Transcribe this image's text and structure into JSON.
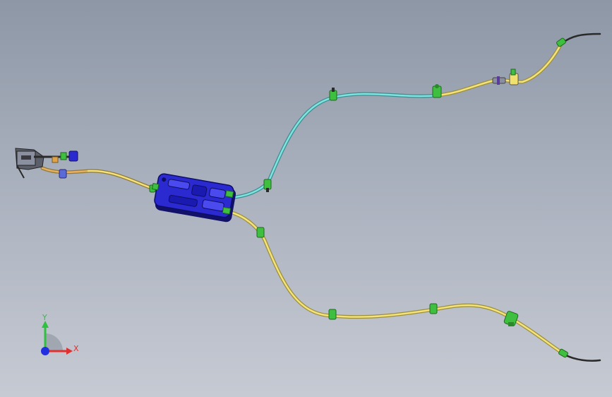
{
  "viewport": {
    "background_top": "#8d97a6",
    "background_bottom": "#c6cad3"
  },
  "colors": {
    "cable_yellow": "#e8d86a",
    "cable_orange": "#e0a34a",
    "cable_cyan": "#5bc6c4",
    "cable_dark": "#3a3a3a",
    "clip_green": "#4cd64c",
    "actuator_blue": "#2a2ad0",
    "connector_grey": "#5a5f6a"
  },
  "components": {
    "actuator": "electric-parking-brake-actuator",
    "switch": "handle-connector-assembly",
    "cables": [
      "front-cable",
      "upper-rear-cable",
      "lower-rear-cable"
    ]
  },
  "triad": {
    "x_label": "X",
    "y_label": "Y",
    "x_color": "#e03030",
    "y_color": "#30c040",
    "z_color": "#2030e0"
  }
}
